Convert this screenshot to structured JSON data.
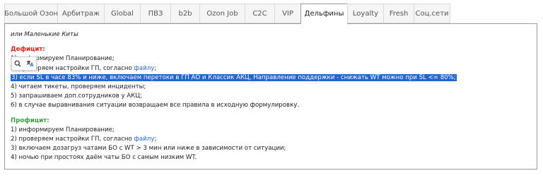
{
  "tabs": [
    {
      "label": "Большой Озон",
      "active": false
    },
    {
      "label": "Арбитраж",
      "active": false
    },
    {
      "label": "Global",
      "active": false
    },
    {
      "label": "ПВЗ",
      "active": false
    },
    {
      "label": "b2b",
      "active": false
    },
    {
      "label": "Ozon Job",
      "active": false
    },
    {
      "label": "C2C",
      "active": false
    },
    {
      "label": "VIP",
      "active": false
    },
    {
      "label": "Дельфины",
      "active": true
    },
    {
      "label": "Loyalty",
      "active": false
    },
    {
      "label": "Fresh",
      "active": false
    },
    {
      "label": "Соц.сети",
      "active": false
    }
  ],
  "content": {
    "intro": "или Маленькие Киты",
    "deficit": {
      "heading": "Дефицит:",
      "line1": "1) информируем Планирование;",
      "line2_pre": "2) проверяем настройки ГП, согласно ",
      "line2_link": "файлу",
      "line2_post": ";",
      "line3": "3) если SL в часе 83% и ниже, включаем перетоки в ГП АО и Классик АКЦ, Направление поддержки - снижать WT можно при SL <= 80%;",
      "line4": "4) читаем тикеты, проверяем инциденты;",
      "line5": "5) запрашиваем доп.сотрудников у АКЦ;",
      "line6": "6) в случае выравнивания ситуации возвращаем все правила в исходную формулировку."
    },
    "profit": {
      "heading": "Профицит:",
      "line1": "1) информируем Планирование;",
      "line2_pre": "2) проверяем настройки ГП, согласно ",
      "line2_link": "файлу",
      "line2_post": ";",
      "line3": "3) включаем дозагруз чатами БО с WT > 3 мин или ниже в зависимости от ситуации;",
      "line4": "4) ночью при простоях даём чаты БО с самым низким WT."
    }
  },
  "toolbar": {
    "icons": [
      "search-icon",
      "translate-icon"
    ],
    "accent": "#1f66d6"
  }
}
